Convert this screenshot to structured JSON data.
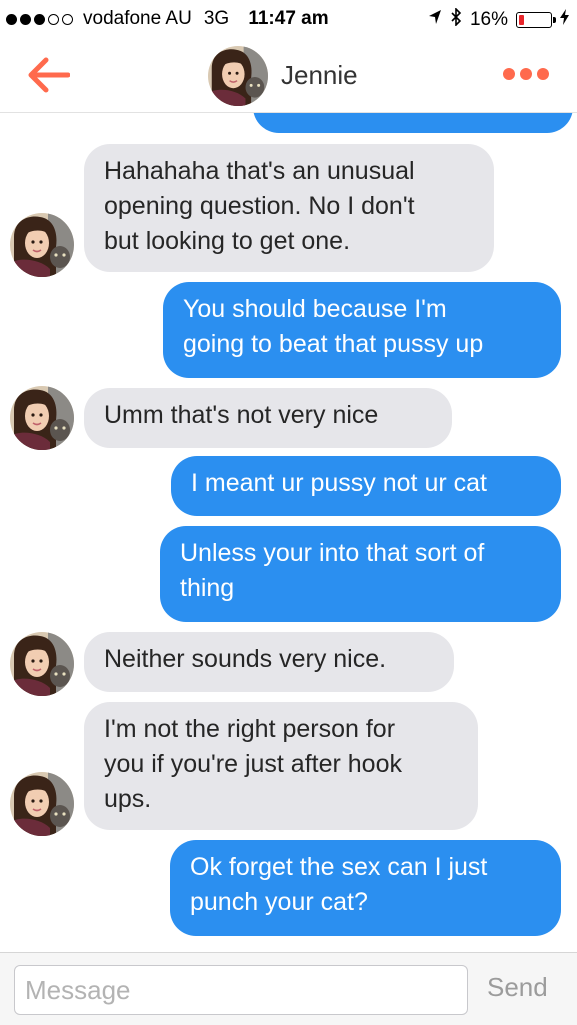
{
  "status_bar": {
    "carrier": "vodafone AU",
    "network": "3G",
    "time": "11:47 am",
    "battery_percent": "16%",
    "battery_level": 0.16
  },
  "header": {
    "contact_name": "Jennie",
    "accent_color": "#ff6a4d"
  },
  "messages": [
    {
      "direction": "outgoing",
      "text": ""
    },
    {
      "direction": "incoming",
      "lines": [
        "Hahahaha that's an unusual",
        "opening question. No I don't",
        "but looking to get one."
      ]
    },
    {
      "direction": "outgoing",
      "lines": [
        "You should because I'm",
        "going to beat that pussy up"
      ]
    },
    {
      "direction": "incoming",
      "lines": [
        "Umm that's not very nice"
      ]
    },
    {
      "direction": "outgoing",
      "lines": [
        "I meant ur pussy not ur cat"
      ]
    },
    {
      "direction": "outgoing",
      "lines": [
        "Unless your into that sort of",
        "thing"
      ]
    },
    {
      "direction": "incoming",
      "lines": [
        "Neither sounds very nice."
      ]
    },
    {
      "direction": "incoming",
      "lines": [
        "I'm not the right person for",
        "you if you're just after hook",
        "ups."
      ]
    },
    {
      "direction": "outgoing",
      "lines": [
        "Ok forget the sex can I just",
        "punch your cat?"
      ]
    }
  ],
  "colors": {
    "incoming_bubble": "#e6e6ea",
    "outgoing_bubble": "#2b8ff0"
  },
  "composer": {
    "placeholder": "Message",
    "value": "",
    "send_label": "Send"
  }
}
